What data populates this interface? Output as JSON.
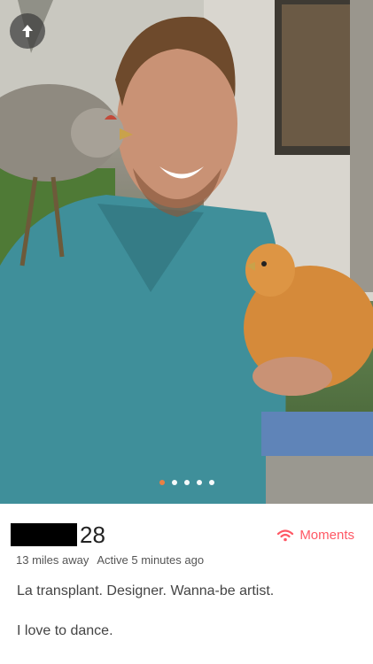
{
  "profile": {
    "age": "28",
    "distance": "13 miles away",
    "active": "Active 5 minutes ago",
    "moments_label": "Moments",
    "bio_line1": "La transplant. Designer. Wanna-be artist.",
    "bio_line2": "I love to dance."
  },
  "photo": {
    "subject": "Man in teal denim shirt holding two chickens",
    "photo_count": 5,
    "active_index": 0
  },
  "icons": {
    "back": "arrow-up-icon",
    "moments": "wifi-signal-icon"
  },
  "colors": {
    "accent": "#ff5864",
    "dot_active": "#f5803e",
    "text_primary": "#222222",
    "text_secondary": "#555555"
  }
}
